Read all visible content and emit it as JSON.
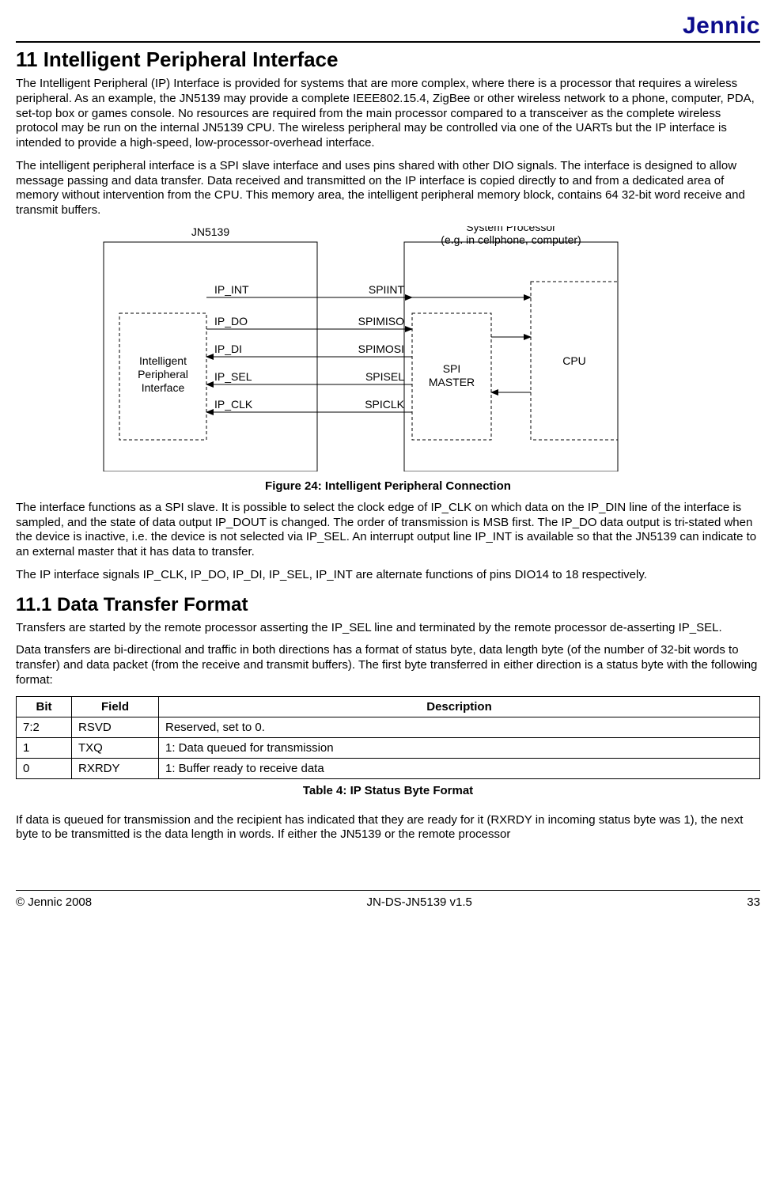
{
  "brand": "Jennic",
  "h1": "11 Intelligent Peripheral Interface",
  "p1": "The Intelligent Peripheral (IP) Interface is provided for systems that are more complex, where there is a processor that requires a wireless peripheral.  As an example, the JN5139 may provide a complete IEEE802.15.4, ZigBee or other wireless network to a phone, computer, PDA, set-top box or games console. No resources are required from the main processor compared to a transceiver as the complete wireless protocol may be run on the internal JN5139 CPU.  The wireless peripheral may be controlled via one of the UARTs but the IP interface is intended to provide a high-speed, low-processor-overhead interface.",
  "p2": "The intelligent peripheral interface is a SPI slave interface and uses pins shared with other DIO signals.  The interface is designed to allow message passing and data transfer.  Data received and transmitted on the IP interface is copied directly to and from a dedicated area of memory without intervention from the CPU.  This memory area, the intelligent peripheral memory block, contains 64 32-bit word receive and transmit buffers.",
  "figure": {
    "left_chip": "JN5139",
    "right_chip_l1": "System Processor",
    "right_chip_l2": "(e.g. in cellphone, computer)",
    "ipi_l1": "Intelligent",
    "ipi_l2": "Peripheral",
    "ipi_l3": "Interface",
    "spi_l1": "SPI",
    "spi_l2": "MASTER",
    "cpu": "CPU",
    "signals": [
      {
        "left": "IP_INT",
        "right": "SPIINT"
      },
      {
        "left": "IP_DO",
        "right": "SPIMISO"
      },
      {
        "left": "IP_DI",
        "right": "SPIMOSI"
      },
      {
        "left": "IP_SEL",
        "right": "SPISEL"
      },
      {
        "left": "IP_CLK",
        "right": "SPICLK"
      }
    ],
    "caption": "Figure 24: Intelligent Peripheral Connection"
  },
  "p3": "The interface functions as a SPI slave.  It is possible to select the clock edge of IP_CLK on which data on the IP_DIN line of the interface is sampled, and the state of data output IP_DOUT is changed.  The order of transmission is MSB first.  The IP_DO data output is tri-stated when the device is inactive, i.e. the device is not selected via IP_SEL.  An interrupt output line IP_INT is available so that the JN5139 can indicate to an external master that it has data to transfer.",
  "p4": "The IP interface signals IP_CLK, IP_DO, IP_DI, IP_SEL, IP_INT are alternate functions of pins DIO14 to 18 respectively.",
  "h2": "11.1  Data Transfer Format",
  "p5": "Transfers are started by the remote processor asserting the IP_SEL line and terminated by the remote processor de-asserting IP_SEL.",
  "p6": "Data transfers are bi-directional and traffic in both directions has a format of status byte, data length byte (of the number of 32-bit words to transfer) and data packet (from the receive and transmit buffers).  The first byte transferred in either direction is a status byte with the following format:",
  "table": {
    "headers": [
      "Bit",
      "Field",
      "Description"
    ],
    "rows": [
      [
        "7:2",
        "RSVD",
        "Reserved, set to 0."
      ],
      [
        "1",
        "TXQ",
        "1: Data queued for transmission"
      ],
      [
        "0",
        "RXRDY",
        "1: Buffer ready to receive data"
      ]
    ],
    "caption": "Table 4: IP Status Byte Format"
  },
  "p7": "If data is queued for transmission and the recipient has indicated that they are ready for it (RXRDY in incoming status byte was 1), the next byte to be transmitted is the data length in words. If either the JN5139 or the remote processor",
  "footer": {
    "left": "© Jennic 2008",
    "center": "JN-DS-JN5139 v1.5",
    "right": "33"
  }
}
